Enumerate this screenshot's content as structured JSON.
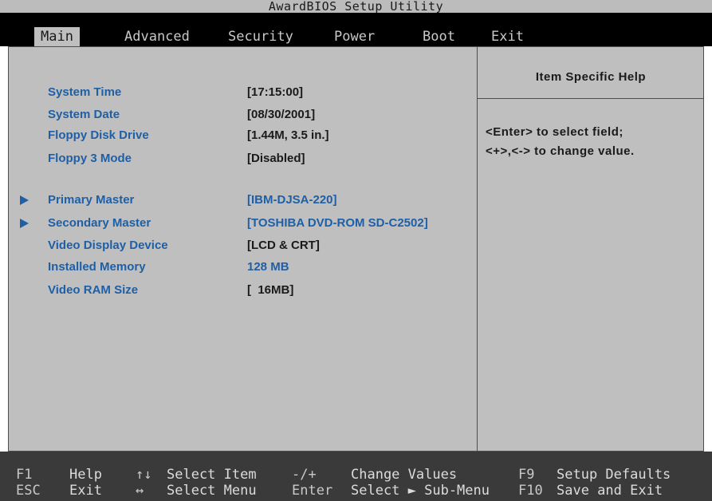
{
  "title": "AwardBIOS Setup Utility",
  "menu": [
    {
      "label": "Main",
      "active": true
    },
    {
      "label": "Advanced",
      "active": false
    },
    {
      "label": "Security",
      "active": false
    },
    {
      "label": "Power",
      "active": false
    },
    {
      "label": "Boot",
      "active": false
    },
    {
      "label": "Exit",
      "active": false
    }
  ],
  "settings": [
    {
      "label": "System Time",
      "value": "[17:15:00]"
    },
    {
      "label": "System Date",
      "value": "[08/30/2001]"
    },
    {
      "label": "Floppy Disk Drive",
      "value": "[1.44M, 3.5 in.]"
    },
    {
      "label": "Floppy 3 Mode",
      "value": "[Disabled]"
    },
    {
      "label": "Primary Master",
      "value": "[IBM-DJSA-220]",
      "submenu": true
    },
    {
      "label": "Secondary Master",
      "value": "[TOSHIBA DVD-ROM SD-C2502]",
      "submenu": true
    },
    {
      "label": "Video Display Device",
      "value": "[LCD & CRT]"
    },
    {
      "label": "Installed Memory",
      "value": "128 MB"
    },
    {
      "label": "Video RAM Size",
      "value": "[  16MB]"
    }
  ],
  "help": {
    "title": "Item Specific Help",
    "line1": "<Enter> to select field;",
    "line2": "<+>,<-> to change value."
  },
  "footer": {
    "help_key": "F1",
    "help_desc": "Help",
    "updown_key": "↑↓",
    "updown_desc": "Select Item",
    "plusminus_key": "-/+",
    "plusminus_desc": "Change Values",
    "f9_key": "F9",
    "f9_desc": "Setup Defaults",
    "esc_key": "ESC",
    "esc_desc": "Exit",
    "leftright_key": "↔",
    "leftright_desc": "Select Menu",
    "enter_key": "Enter",
    "enter_desc": "Select ► Sub-Menu",
    "f10_key": "F10",
    "f10_desc": "Save and Exit"
  },
  "colors": {
    "item_label": "#1f5fa6",
    "panel_bg": "#bfbfbf",
    "menu_bg": "#000000",
    "footer_bg": "#3a3a3a"
  }
}
